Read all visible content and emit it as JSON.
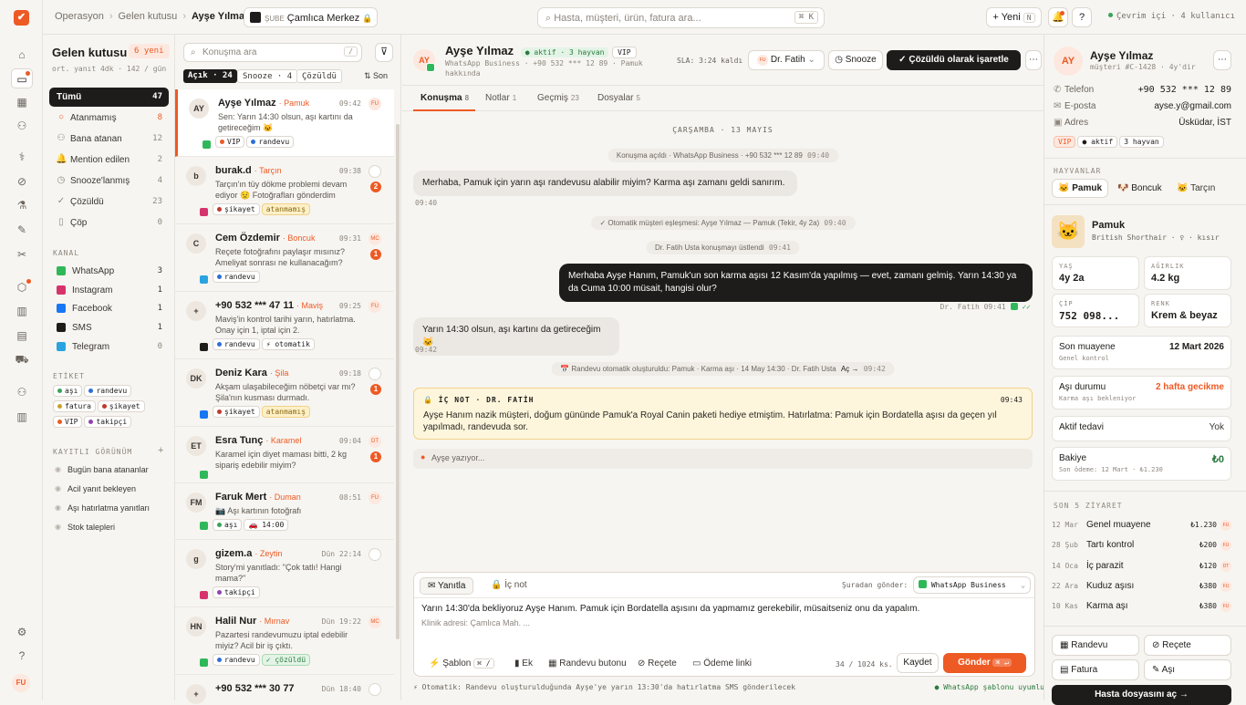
{
  "topbar": {
    "crumbs": [
      "Operasyon",
      "Gelen kutusu",
      "Ayşe Yılmaz"
    ],
    "branch_key": "ŞUBE",
    "branch": "Çamlıca Merkez",
    "search": "Hasta, müşteri, ürün, fatura ara...",
    "search_kbd": "⌘ K",
    "new_label": "Yeni",
    "new_kbd": "N",
    "online": "Çevrim içi · 4 kullanıcı"
  },
  "rail": {
    "user": "FU"
  },
  "inbox": {
    "title": "Gelen kutusu",
    "new_badge": "6 yeni",
    "subtitle": "ort. yanıt 4dk · 142 / gün",
    "folders": [
      {
        "label": "Tümü",
        "count": "47",
        "icon": "inbox-icon"
      },
      {
        "label": "Atanmamış",
        "count": "8",
        "icon": "circle-icon"
      },
      {
        "label": "Bana atanan",
        "count": "12",
        "icon": "user-icon"
      },
      {
        "label": "Mention edilen",
        "count": "2",
        "icon": "bell-icon"
      },
      {
        "label": "Snooze'lanmış",
        "count": "4",
        "icon": "clock-icon"
      },
      {
        "label": "Çözüldü",
        "count": "23",
        "icon": "check-icon"
      },
      {
        "label": "Çöp",
        "count": "0",
        "icon": "trash-icon"
      }
    ],
    "channel_title": "KANAL",
    "channels": [
      {
        "label": "WhatsApp",
        "count": "3",
        "color": "#2fb85a"
      },
      {
        "label": "Instagram",
        "count": "1",
        "color": "#d6336c"
      },
      {
        "label": "Facebook",
        "count": "1",
        "color": "#1877f2"
      },
      {
        "label": "SMS",
        "count": "1",
        "color": "#1e1c1a"
      },
      {
        "label": "Telegram",
        "count": "0",
        "color": "#2aa3e0"
      }
    ],
    "tags_title": "ETİKET",
    "tags": [
      {
        "label": "aşı",
        "color": "#3aa35a"
      },
      {
        "label": "randevu",
        "color": "#2f6fd6"
      },
      {
        "label": "fatura",
        "color": "#c9a227"
      },
      {
        "label": "şikayet",
        "color": "#c0392b"
      },
      {
        "label": "VIP",
        "color": "#ee5a24"
      },
      {
        "label": "takipçi",
        "color": "#8e44ad"
      }
    ],
    "views_title": "KAYITLI GÖRÜNÜM",
    "views": [
      "Bugün bana atananlar",
      "Acil yanıt bekleyen",
      "Aşı hatırlatma yanıtları",
      "Stok talepleri"
    ]
  },
  "clist": {
    "search": "Konuşma ara",
    "search_kbd": "/",
    "tabs": [
      {
        "label": "Açık · 24"
      },
      {
        "label": "Snooze · 4"
      },
      {
        "label": "Çözüldü"
      }
    ],
    "sort": "Son",
    "items": [
      {
        "av": "AY",
        "name": "Ayşe Yılmaz",
        "pet": "· Pamuk",
        "time": "09:42",
        "assignee": "FU",
        "preview": "Sen: Yarın 14:30 olsun, aşı kartını da getireceğim 🐱",
        "tags": [
          "VIP",
          "randevu"
        ],
        "tagc": [
          "#ee5a24",
          "#2f6fd6"
        ],
        "ch": "#2fb85a",
        "unread": ""
      },
      {
        "av": "b",
        "name": "burak.d",
        "pet": "· Tarçın",
        "time": "09:38",
        "assignee": "",
        "preview": "Tarçın'ın tüy dökme problemi devam ediyor 😟 Fotoğrafları gönderdim",
        "tags": [
          "şikayet",
          "atanmamış"
        ],
        "tagc": [
          "#c0392b",
          ""
        ],
        "ch": "#d6336c",
        "unread": "2"
      },
      {
        "av": "C",
        "name": "Cem Özdemir",
        "pet": "· Boncuk",
        "time": "09:31",
        "assignee": "MC",
        "preview": "Reçete fotoğrafını paylaşır mısınız? Ameliyat sonrası ne kullanacağım?",
        "tags": [
          "randevu"
        ],
        "tagc": [
          "#2f6fd6"
        ],
        "ch": "#2aa3e0",
        "unread": "1"
      },
      {
        "av": "+",
        "name": "+90 532 *** 47 11",
        "pet": "· Maviş",
        "time": "09:25",
        "assignee": "FU",
        "preview": "Maviş'in kontrol tarihi yarın, hatırlatma. Onay için 1, iptal için 2.",
        "tags": [
          "randevu",
          "⚡ otomatik"
        ],
        "tagc": [
          "#2f6fd6",
          ""
        ],
        "ch": "#1e1c1a",
        "unread": ""
      },
      {
        "av": "DK",
        "name": "Deniz Kara",
        "pet": "· Şila",
        "time": "09:18",
        "assignee": "",
        "preview": "Akşam ulaşabileceğim nöbetçi var mı? Şila'nın kusması durmadı.",
        "tags": [
          "şikayet",
          "atanmamış"
        ],
        "tagc": [
          "#c0392b",
          ""
        ],
        "ch": "#1877f2",
        "unread": "1"
      },
      {
        "av": "ET",
        "name": "Esra Tunç",
        "pet": "· Karamel",
        "time": "09:04",
        "assignee": "DT",
        "preview": "Karamel için diyet maması bitti, 2 kg sipariş edebilir miyim?",
        "tags": [],
        "tagc": [],
        "ch": "#2fb85a",
        "unread": "1"
      },
      {
        "av": "FM",
        "name": "Faruk Mert",
        "pet": "· Duman",
        "time": "08:51",
        "assignee": "FU",
        "preview": "📷 Aşı kartının fotoğrafı",
        "tags": [
          "aşı",
          "🚗 14:00"
        ],
        "tagc": [
          "#3aa35a",
          ""
        ],
        "ch": "#2fb85a",
        "unread": ""
      },
      {
        "av": "g",
        "name": "gizem.a",
        "pet": "· Zeytin",
        "time": "Dün 22:14",
        "assignee": "",
        "preview": "Story'mi yanıtladı: \"Çok tatlı! Hangi mama?\"",
        "tags": [
          "takipçi"
        ],
        "tagc": [
          "#8e44ad"
        ],
        "ch": "#d6336c",
        "unread": ""
      },
      {
        "av": "HN",
        "name": "Halil Nur",
        "pet": "· Mırnav",
        "time": "Dün 19:22",
        "assignee": "MC",
        "preview": "Pazartesi randevumuzu iptal edebilir miyiz? Acil bir iş çıktı.",
        "tags": [
          "randevu",
          "✓ çözüldü"
        ],
        "tagc": [
          "#2f6fd6",
          ""
        ],
        "ch": "#2fb85a",
        "unread": ""
      },
      {
        "av": "+",
        "name": "+90 532 *** 30 77",
        "pet": "",
        "time": "Dün 18:40",
        "assignee": "",
        "preview": "",
        "tags": [],
        "tagc": [],
        "ch": "#1e1c1a",
        "unread": ""
      }
    ]
  },
  "chat": {
    "name": "Ayşe Yılmaz",
    "av": "AY",
    "status": "aktif · 3 hayvan",
    "vip": "VIP",
    "meta": "WhatsApp Business · +90 532 *** 12 89 · Pamuk hakkında",
    "sla": "SLA: 3:24 kaldı",
    "assignee_av": "FU",
    "assignee": "Dr. Fatih",
    "snooze": "Snooze",
    "resolve": "Çözüldü olarak işaretle",
    "tabs": [
      {
        "label": "Konuşma",
        "count": "8"
      },
      {
        "label": "Notlar",
        "count": "1"
      },
      {
        "label": "Geçmiş",
        "count": "23"
      },
      {
        "label": "Dosyalar",
        "count": "5"
      }
    ],
    "day": "ÇARŞAMBA · 13 MAYIS",
    "sys1": "Konuşma açıldı · WhatsApp Business · +90 532 *** 12 89",
    "sys1_time": "09:40",
    "msg1": "Merhaba, Pamuk için yarın aşı randevusu alabilir miyim? Karma aşı zamanı geldi sanırım.",
    "msg1_time": "09:40",
    "sys2": "✓ Otomatik müşteri eşleşmesi: Ayşe Yılmaz — Pamuk (Tekir, 4y 2a)",
    "sys2_time": "09:40",
    "sys3": "Dr. Fatih Usta konuşmayı üstlendi",
    "sys3_time": "09:41",
    "msg2": "Merhaba Ayşe Hanım, Pamuk'un son karma aşısı 12 Kasım'da yapılmış — evet, zamanı gelmiş. Yarın 14:30 ya da Cuma 10:00 müsait, hangisi olur?",
    "msg2_meta": "Dr. Fatih 09:41",
    "msg2_tick": "✓✓",
    "msg3": "Yarın 14:30 olsun, aşı kartını da getireceğim 🐱",
    "msg3_time": "09:42",
    "sys4": "📅 Randevu otomatik oluşturuldu: Pamuk · Karma aşı · 14 May 14:30 · Dr. Fatih Usta",
    "sys4_link": "Aç →",
    "sys4_time": "09:42",
    "note_head": "🔒 İÇ NOT · DR. FATİH",
    "note_time": "09:43",
    "note_text": "Ayşe Hanım nazik müşteri, doğum gününde Pamuk'a Royal Canin paketi hediye etmiştim. Hatırlatma: Pamuk için Bordatella aşısı da geçen yıl yapılmadı, randevuda sor.",
    "typing": "Ayşe yazıyor...",
    "compose": {
      "tab_reply": "Yanıtla",
      "tab_note": "İç not",
      "from_label": "Şuradan gönder:",
      "from": "WhatsApp Business",
      "draft": "Yarın 14:30'da bekliyoruz Ayşe Hanım. Pamuk için Bordatella aşısını da yapmamız gerekebilir, müsaitseniz onu da yapalım.",
      "placeholder": "Klinik adresi: Çamlıca Mah. ...",
      "tools": [
        "Şablon",
        "Ek",
        "Randevu butonu",
        "Reçete",
        "Ödeme linki"
      ],
      "tmpl_kbd": "⌘ /",
      "counter": "34 / 1024 ks.",
      "save": "Kaydet",
      "send": "Gönder",
      "send_kbd": "⌘ ↵"
    },
    "footer": "⚡ Otomatik: Randevu oluşturulduğunda Ayşe'ye yarın 13:30'da hatırlatma SMS gönderilecek",
    "footer_right": "● WhatsApp şablonu uyumlu"
  },
  "customer": {
    "av": "AY",
    "name": "Ayşe Yılmaz",
    "sub": "müşteri #C-1428 · 4y'dir",
    "phone_l": "Telefon",
    "phone": "+90 532 *** 12 89",
    "email_l": "E-posta",
    "email": "ayse.y@gmail.com",
    "addr_l": "Adres",
    "addr": "Üsküdar, İST",
    "badges": [
      "VIP",
      "aktif",
      "3 hayvan"
    ],
    "pets_title": "HAYVANLAR",
    "pets": [
      "Pamuk",
      "Boncuk",
      "Tarçın"
    ],
    "pet_name": "Pamuk",
    "pet_breed": "British Shorthair · ♀ · kısır",
    "stats": [
      {
        "k": "YAŞ",
        "v": "4y 2a"
      },
      {
        "k": "AĞIRLIK",
        "v": "4.2 kg"
      },
      {
        "k": "ÇİP",
        "v": "752 098..."
      },
      {
        "k": "RENK",
        "v": "Krem & beyaz"
      }
    ],
    "last_exam_l": "Son muayene",
    "last_exam_s": "Genel kontrol",
    "last_exam": "12 Mart 2026",
    "vacc_l": "Aşı durumu",
    "vacc_s": "Karma aşı bekleniyor",
    "vacc": "2 hafta gecikme",
    "treat_l": "Aktif tedavi",
    "treat": "Yok",
    "bal_l": "Bakiye",
    "bal_s": "Son ödeme: 12 Mart · ₺1.230",
    "bal": "₺0",
    "visits_title": "SON 5 ZİYARET",
    "visits": [
      {
        "d": "12 Mar",
        "n": "Genel muayene",
        "p": "₺1.230",
        "i": "FU"
      },
      {
        "d": "28 Şub",
        "n": "Tartı kontrol",
        "p": "₺200",
        "i": "FU"
      },
      {
        "d": "14 Oca",
        "n": "İç parazit",
        "p": "₺120",
        "i": "DT"
      },
      {
        "d": "22 Ara",
        "n": "Kuduz aşısı",
        "p": "₺380",
        "i": "FU"
      },
      {
        "d": "10 Kas",
        "n": "Karma aşı",
        "p": "₺380",
        "i": "FU"
      }
    ],
    "actions": [
      "Randevu",
      "Reçete",
      "Fatura",
      "Aşı"
    ],
    "open_file": "Hasta dosyasını aç →"
  },
  "colors": {
    "accent": "#ee5a24",
    "dark": "#1e1c1a",
    "bg": "#f7f5f1"
  }
}
